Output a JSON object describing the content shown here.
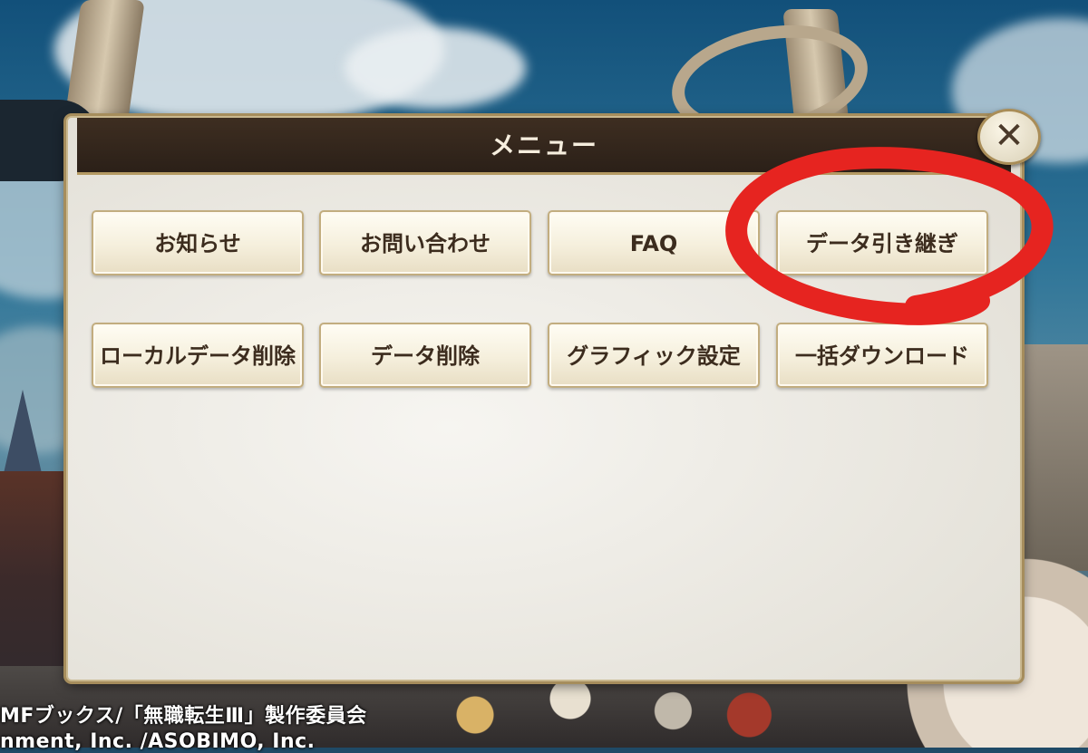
{
  "dialog": {
    "title": "メニュー",
    "close_icon": "close-icon",
    "buttons": [
      {
        "label": "お知らせ"
      },
      {
        "label": "お問い合わせ"
      },
      {
        "label": "FAQ"
      },
      {
        "label": "データ引き継ぎ"
      },
      {
        "label": "ローカルデータ削除"
      },
      {
        "label": "データ削除"
      },
      {
        "label": "グラフィック設定"
      },
      {
        "label": "一括ダウンロード"
      }
    ]
  },
  "footer": {
    "copyright_line1": "MFブックス/「無職転生Ⅲ」製作委員会",
    "copyright_line2": "nment, Inc. /ASOBIMO, Inc."
  },
  "annotation": {
    "color": "#e62420",
    "target": "データ引き継ぎ"
  },
  "colors": {
    "title_bar": "#2b2018",
    "panel": "#ece9e0",
    "button_text": "#3c2c1e"
  }
}
